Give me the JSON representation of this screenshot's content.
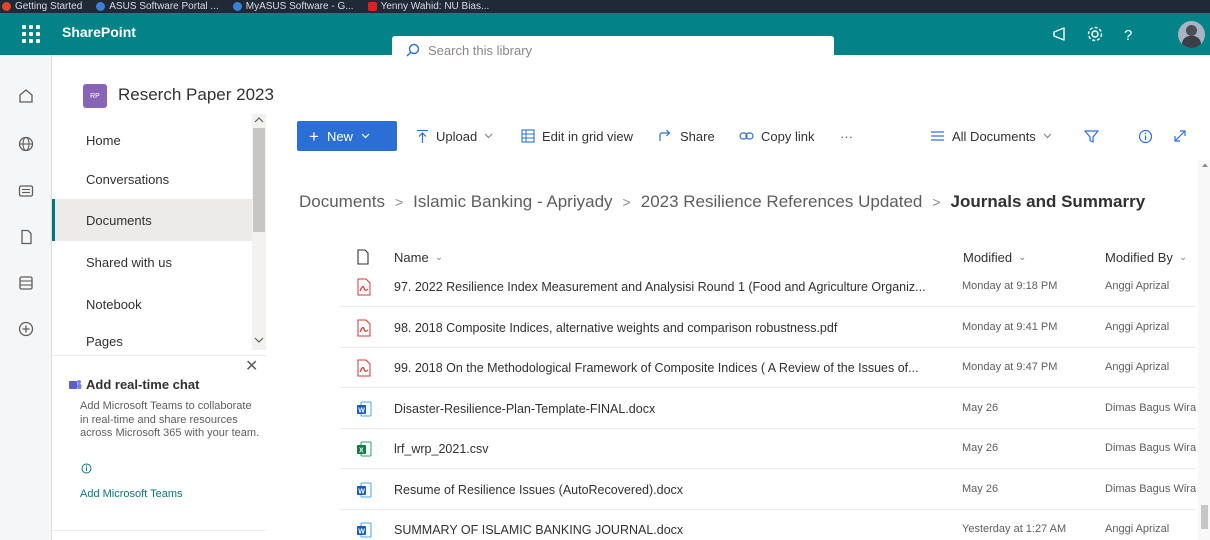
{
  "bookmarks": [
    {
      "label": "Getting Started",
      "color": "#e2452b"
    },
    {
      "label": "ASUS Software Portal ...",
      "color": "#3b82d6"
    },
    {
      "label": "MyASUS Software - G...",
      "color": "#3b82d6"
    },
    {
      "label": "Yenny Wahid: NU Bias...",
      "color": "#e02020"
    }
  ],
  "suite": {
    "brand": "SharePoint",
    "search_placeholder": "Search this library"
  },
  "site": {
    "logo_text": "RP",
    "title": "Reserch Paper 2023"
  },
  "nav": {
    "items": [
      {
        "label": "Home"
      },
      {
        "label": "Conversations"
      },
      {
        "label": "Documents"
      },
      {
        "label": "Shared with us"
      },
      {
        "label": "Notebook"
      },
      {
        "label": "Pages"
      }
    ],
    "active": "Documents"
  },
  "promo": {
    "title": "Add real-time chat",
    "body": "Add Microsoft Teams to collaborate in real-time and share resources across Microsoft 365 with your team.",
    "link": "Add Microsoft Teams"
  },
  "commands": {
    "new": "New",
    "upload": "Upload",
    "grid": "Edit in grid view",
    "share": "Share",
    "copy": "Copy link",
    "more": "···",
    "view": "All Documents"
  },
  "breadcrumb": {
    "items": [
      "Documents",
      "Islamic Banking - Apriyady",
      "2023 Resilience References Updated"
    ],
    "current": "Journals and Summarry"
  },
  "list": {
    "columns": {
      "name": "Name",
      "modified": "Modified",
      "modified_by": "Modified By"
    },
    "rows": [
      {
        "type": "pdf",
        "name": "97. 2022 Resilience Index Measurement and Analysisi Round 1 (Food and Agriculture Organiz...",
        "modified": "Monday at 9:18 PM",
        "by": "Anggi Aprizal"
      },
      {
        "type": "pdf",
        "name": "98. 2018 Composite Indices, alternative weights and comparison robustness.pdf",
        "modified": "Monday at 9:41 PM",
        "by": "Anggi Aprizal"
      },
      {
        "type": "pdf",
        "name": "99. 2018 On the Methodological Framework of Composite Indices ( A Review of the Issues of...",
        "modified": "Monday at 9:47 PM",
        "by": "Anggi Aprizal"
      },
      {
        "type": "word",
        "name": "Disaster-Resilience-Plan-Template-FINAL.docx",
        "modified": "May 26",
        "by": "Dimas Bagus Wiran"
      },
      {
        "type": "excel",
        "name": "lrf_wrp_2021.csv",
        "modified": "May 26",
        "by": "Dimas Bagus Wiran"
      },
      {
        "type": "word",
        "name": "Resume of Resilience Issues (AutoRecovered).docx",
        "modified": "May 26",
        "by": "Dimas Bagus Wiran"
      },
      {
        "type": "word",
        "name": "SUMMARY OF ISLAMIC BANKING JOURNAL.docx",
        "modified": "Yesterday at 1:27 AM",
        "by": "Anggi Aprizal"
      }
    ]
  },
  "colors": {
    "suitebar": "#038387",
    "primary": "#2b6fd6",
    "site_logo": "#8764b8"
  }
}
